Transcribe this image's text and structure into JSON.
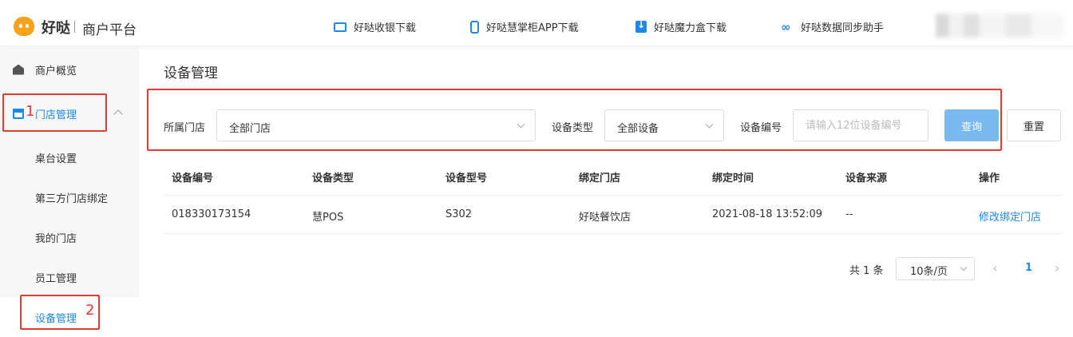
{
  "header": {
    "brand": "好哒",
    "brand_sub": "商户平台",
    "links": [
      {
        "label": "好哒收银下载",
        "icon": "monitor-icon"
      },
      {
        "label": "好哒慧掌柜APP下载",
        "icon": "phone-icon"
      },
      {
        "label": "好哒魔力盒下载",
        "icon": "download-icon"
      },
      {
        "label": "好哒数据同步助手",
        "icon": "link-icon"
      }
    ]
  },
  "sidebar": {
    "items": [
      {
        "label": "商户概览",
        "icon": "home-icon"
      },
      {
        "label": "门店管理",
        "icon": "store-icon",
        "expanded": true
      },
      {
        "label": "桌台设置"
      },
      {
        "label": "第三方门店绑定"
      },
      {
        "label": "我的门店"
      },
      {
        "label": "员工管理"
      },
      {
        "label": "设备管理",
        "active": true
      }
    ]
  },
  "annotations": {
    "num1": "1",
    "num2": "2"
  },
  "main": {
    "title": "设备管理",
    "filters": {
      "store_label": "所属门店",
      "store_value": "全部门店",
      "type_label": "设备类型",
      "type_value": "全部设备",
      "serial_label": "设备编号",
      "serial_placeholder": "请输入12位设备编号",
      "query_label": "查询",
      "reset_label": "重置"
    },
    "table": {
      "columns": [
        "设备编号",
        "设备类型",
        "设备型号",
        "绑定门店",
        "绑定时间",
        "设备来源",
        "操作"
      ],
      "rows": [
        [
          "018330173154",
          "慧POS",
          "S302",
          "好哒餐饮店",
          "2021-08-18 13:52:09",
          "--",
          "修改绑定门店"
        ]
      ]
    },
    "pagination": {
      "total": "共 1 条",
      "page_size": "10条/页",
      "prev": "‹",
      "current": "1",
      "next": "›"
    }
  },
  "colors": {
    "accent": "#1e88e5",
    "brand": "#f7a21b",
    "highlight": "#e53935"
  }
}
